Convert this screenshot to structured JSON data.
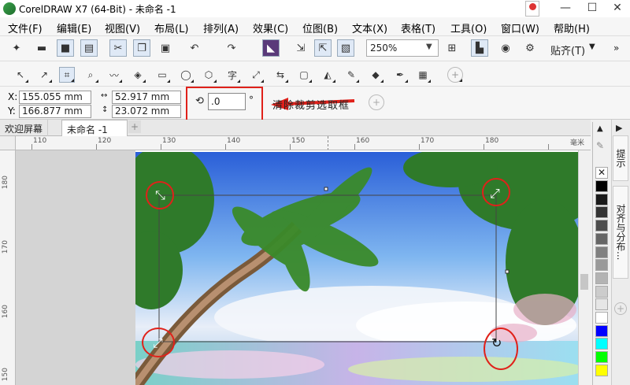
{
  "window": {
    "title": "CorelDRAW X7 (64-Bit) - 未命名 -1",
    "minimize": "—",
    "maximize": "☐",
    "close": "✕"
  },
  "menu": [
    "文件(F)",
    "编辑(E)",
    "视图(V)",
    "布局(L)",
    "排列(A)",
    "效果(C)",
    "位图(B)",
    "文本(X)",
    "表格(T)",
    "工具(O)",
    "窗口(W)",
    "帮助(H)"
  ],
  "toolbar": {
    "zoom_value": "250%",
    "snap_label": "贴齐(T)",
    "icons": [
      "new-icon",
      "open-icon",
      "save-icon",
      "print-icon",
      "cut-icon",
      "copy-icon",
      "paste-icon",
      "undo-icon",
      "redo-icon",
      "import-icon",
      "export-icon",
      "publish-icon",
      "corel-connect-icon",
      "launch-icon",
      "options-icon",
      "fullscreen-icon",
      "rulers-icon"
    ]
  },
  "tools": [
    "pick-tool-icon",
    "shape-tool-icon",
    "crop-tool-icon",
    "zoom-tool-icon",
    "freehand-tool-icon",
    "smart-fill-icon",
    "rectangle-tool-icon",
    "ellipse-tool-icon",
    "polygon-tool-icon",
    "text-tool-icon",
    "dimension-tool-icon",
    "connector-tool-icon",
    "drop-shadow-tool-icon",
    "transparency-tool-icon",
    "eyedropper-tool-icon",
    "interactive-fill-icon",
    "smart-fill-tool-icon",
    "pen-icon",
    "add-tool-icon"
  ],
  "properties": {
    "x_label": "X:",
    "x_value": "155.055 mm",
    "y_label": "Y:",
    "y_value": "166.877 mm",
    "w_value": "52.917 mm",
    "h_value": "23.072 mm",
    "rotation_value": ".0",
    "rotation_unit": "°",
    "clear_crop_label": "清除裁剪选取框"
  },
  "tabs": {
    "welcome": "欢迎屏幕",
    "document": "未命名 -1"
  },
  "ruler": {
    "h_labels": [
      "110",
      "120",
      "130",
      "140",
      "150",
      "160",
      "170",
      "180"
    ],
    "unit": "毫米",
    "v_labels": [
      "180",
      "170",
      "160",
      "150"
    ]
  },
  "dock": {
    "hints": "提示",
    "align": "对齐与分布..."
  },
  "palette_colors": [
    "#000000",
    "#1a1a1a",
    "#333333",
    "#4d4d4d",
    "#666666",
    "#808080",
    "#999999",
    "#b3b3b3",
    "#cccccc",
    "#e6e6e6",
    "#ffffff",
    "#0000ff",
    "#00ffff",
    "#00ff00",
    "#ffff00"
  ],
  "colors": {
    "annotation_red": "#e0211a"
  }
}
